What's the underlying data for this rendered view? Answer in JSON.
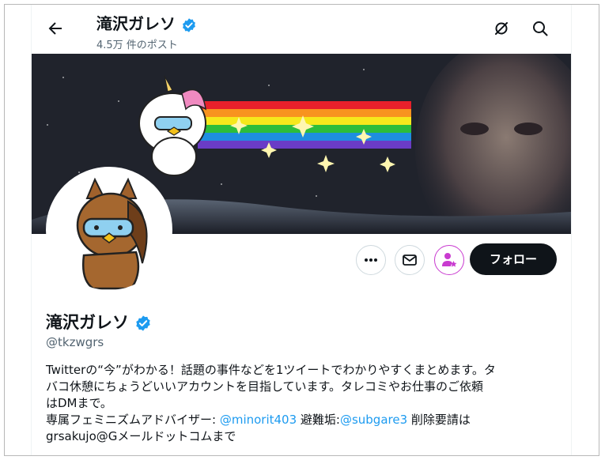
{
  "header": {
    "title": "滝沢ガレソ",
    "post_count": "4.5万 件のポスト"
  },
  "profile": {
    "name": "滝沢ガレソ",
    "handle": "@tkzwgrs",
    "follow_label": "フォロー",
    "bio": {
      "line1": "Twitterの“今”がわかる！話題の事件などを1ツイートでわかりやすくまとめます。タ",
      "line2": "バコ休憩にちょうどいいアカウントを目指しています。タレコミやお仕事のご依頼",
      "line3": "はDMまで。",
      "line4_prefix": "専属フェミニズムアドバイザー: ",
      "line4_link1": "@minorit403",
      "line4_mid": " 避難垢:",
      "line4_link2": "@subgare3",
      "line4_suffix": " 削除要請は",
      "line5": "grsakujo@Gメールドットコムまで"
    }
  },
  "icons": {
    "back": "arrow-left-icon",
    "hide": "eye-slash-icon",
    "search": "search-icon",
    "verified": "verified-badge-icon",
    "more": "more-icon",
    "message": "mail-icon",
    "notify": "person-star-icon"
  },
  "colors": {
    "verified": "#1d9bf0",
    "follow_bg": "#0f1419",
    "notify": "#c93bd0",
    "link": "#1d9bf0"
  }
}
